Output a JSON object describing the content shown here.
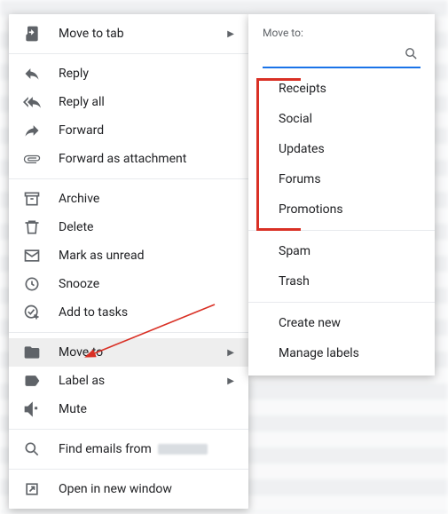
{
  "context_menu": {
    "move_to_tab": "Move to tab",
    "reply": "Reply",
    "reply_all": "Reply all",
    "forward": "Forward",
    "forward_attach": "Forward as attachment",
    "archive": "Archive",
    "delete": "Delete",
    "mark_unread": "Mark as unread",
    "snooze": "Snooze",
    "add_tasks": "Add to tasks",
    "move_to": "Move to",
    "label_as": "Label as",
    "mute": "Mute",
    "find_emails": "Find emails from ",
    "open_new": "Open in new window"
  },
  "submenu": {
    "header": "Move to:",
    "search_ph": "",
    "labels": {
      "0": "Receipts",
      "1": "Social",
      "2": "Updates",
      "3": "Forums",
      "4": "Promotions"
    },
    "system": {
      "spam": "Spam",
      "trash": "Trash"
    },
    "actions": {
      "create": "Create new",
      "manage": "Manage labels"
    }
  }
}
